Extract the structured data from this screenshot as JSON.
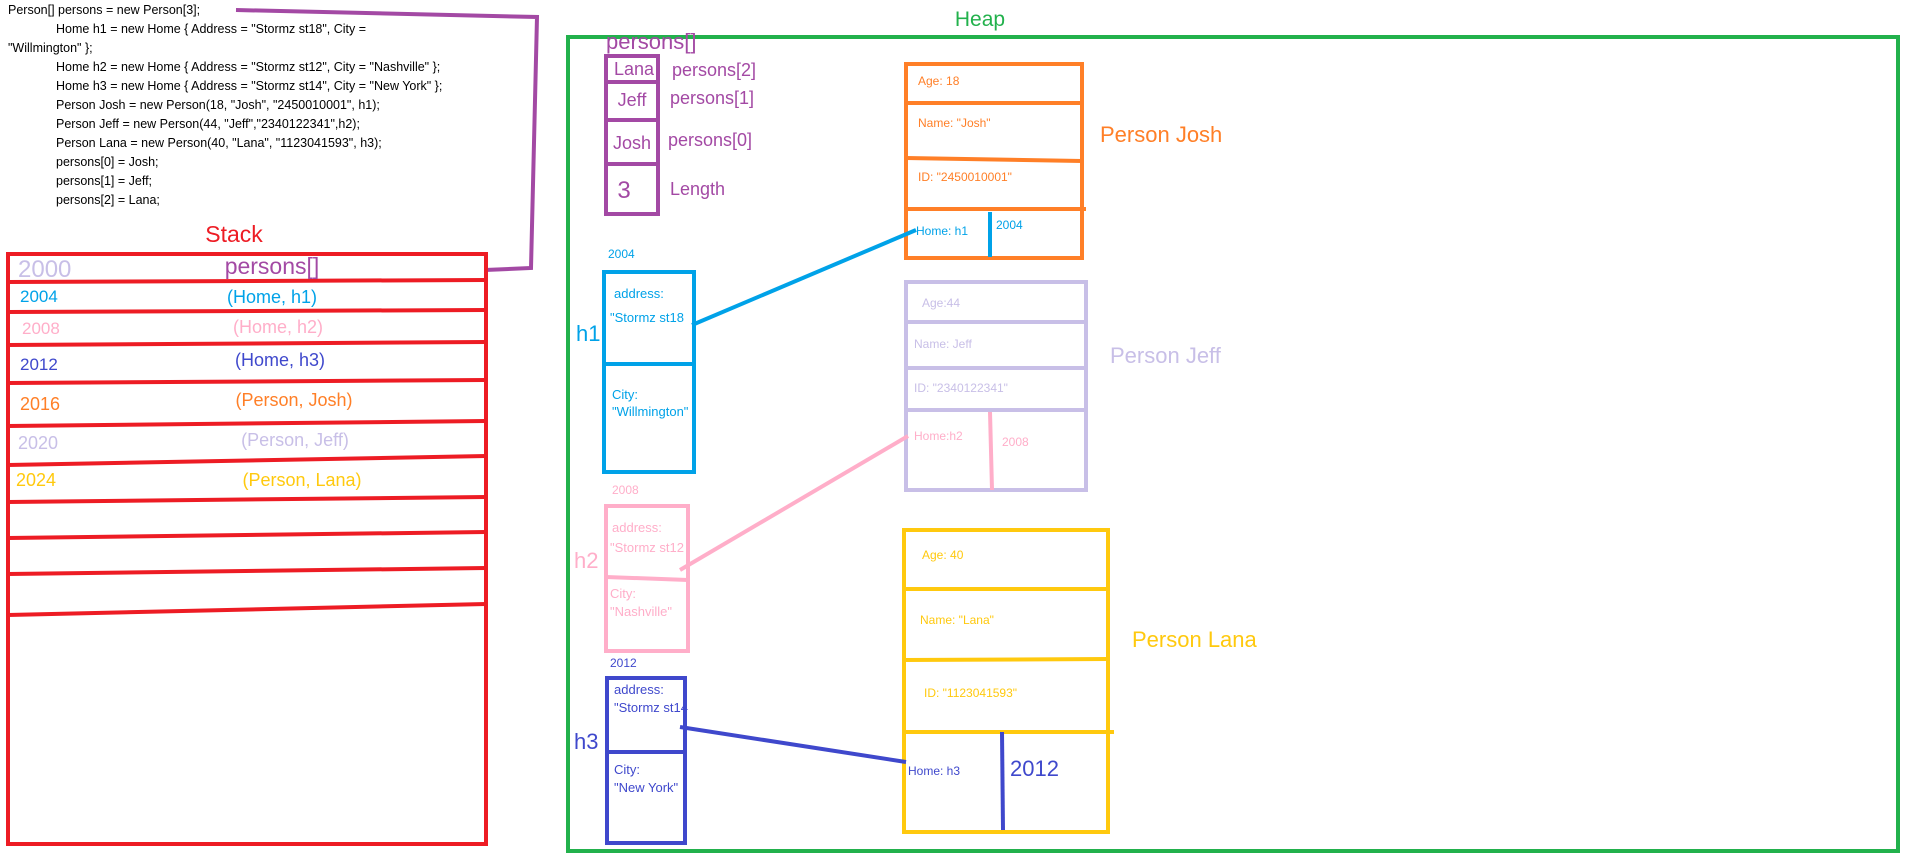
{
  "code": [
    "Person[] persons = new Person[3];",
    "    Home h1 = new Home { Address = \"Stormz st18\", City =",
    "\"Willmington\" };",
    "    Home h2 = new Home { Address = \"Stormz st12\", City = \"Nashville\" };",
    "    Home h3 = new Home { Address = \"Stormz st14\", City = \"New York\" };",
    "    Person Josh =  new Person(18, \"Josh\", \"2450010001\", h1);",
    "    Person Jeff = new Person(44, \"Jeff\",\"2340122341\",h2);",
    "    Person Lana = new Person(40, \"Lana\", \"1123041593\", h3);",
    "    persons[0] = Josh;",
    "    persons[1] = Jeff;",
    "    persons[2] = Lana;"
  ],
  "stack": {
    "title": "Stack",
    "rows": [
      {
        "addr": "2000",
        "value": "persons[]"
      },
      {
        "addr": "2004",
        "value": "(Home, h1)"
      },
      {
        "addr": "2008",
        "value": "(Home, h2)"
      },
      {
        "addr": "2012",
        "value": "(Home, h3)"
      },
      {
        "addr": "2016",
        "value": "(Person, Josh)"
      },
      {
        "addr": "2020",
        "value": "(Person, Jeff)"
      },
      {
        "addr": "2024",
        "value": "(Person, Lana)"
      }
    ]
  },
  "heap": {
    "title": "Heap",
    "array": {
      "title": "persons[]",
      "cells": [
        {
          "value": "Lana",
          "label": "persons[2]"
        },
        {
          "value": "Jeff",
          "label": "persons[1]"
        },
        {
          "value": "Josh",
          "label": "persons[0]"
        },
        {
          "value": "3",
          "label": "Length"
        }
      ]
    },
    "homes": [
      {
        "name": "h1",
        "addr": "2004",
        "address_label": "address:",
        "address_value": "\"Stormz st18",
        "city_label": "City:",
        "city_value": "\"Willmington\""
      },
      {
        "name": "h2",
        "addr": "2008",
        "address_label": "address:",
        "address_value": "\"Stormz st12",
        "city_label": "City:",
        "city_value": "\"Nashville\""
      },
      {
        "name": "h3",
        "addr": "2012",
        "address_label": "address:",
        "address_value": "\"Stormz st14",
        "city_label": "City:",
        "city_value": "\"New York\""
      }
    ],
    "persons": [
      {
        "title": "Person Josh",
        "age": "Age: 18",
        "name": "Name: \"Josh\"",
        "id": "ID: \"2450010001\"",
        "home": "Home: h1",
        "home_addr": "2004"
      },
      {
        "title": "Person Jeff",
        "age": "Age:44",
        "name": "Name: Jeff",
        "id": "ID:  \"2340122341\"",
        "home": "Home:h2",
        "home_addr": "2008"
      },
      {
        "title": "Person Lana",
        "age": "Age: 40",
        "name": "Name: \"Lana\"",
        "id": "ID: \"1123041593\"",
        "home": "Home: h3",
        "home_addr": "2012"
      }
    ]
  },
  "colors": {
    "stack": "#ed1c24",
    "heap": "#22b14c",
    "purple": "#a349a4",
    "lavender": "#c8bfe7",
    "blue": "#00a2e8",
    "pink": "#ffaec9",
    "indigo": "#3f48cc",
    "orange": "#ff7f27",
    "yellow": "#ffc90e",
    "text": "#000000"
  }
}
